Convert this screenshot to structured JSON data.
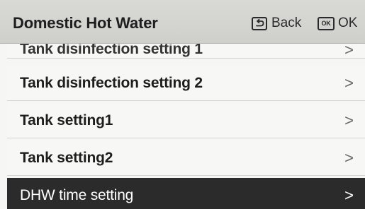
{
  "header": {
    "title": "Domestic Hot Water",
    "back_label": "Back",
    "ok_icon_text": "OK",
    "ok_label": "OK"
  },
  "menu": {
    "items": [
      {
        "label": "Tank disinfection setting 1",
        "chevron": ">"
      },
      {
        "label": "Tank disinfection setting 2",
        "chevron": ">"
      },
      {
        "label": "Tank setting1",
        "chevron": ">"
      },
      {
        "label": "Tank setting2",
        "chevron": ">"
      },
      {
        "label": "DHW time setting",
        "chevron": ">",
        "selected": true
      }
    ]
  },
  "colors": {
    "header_bg": "#d4d4d1",
    "selected_row_bg": "#2b2b2b"
  }
}
